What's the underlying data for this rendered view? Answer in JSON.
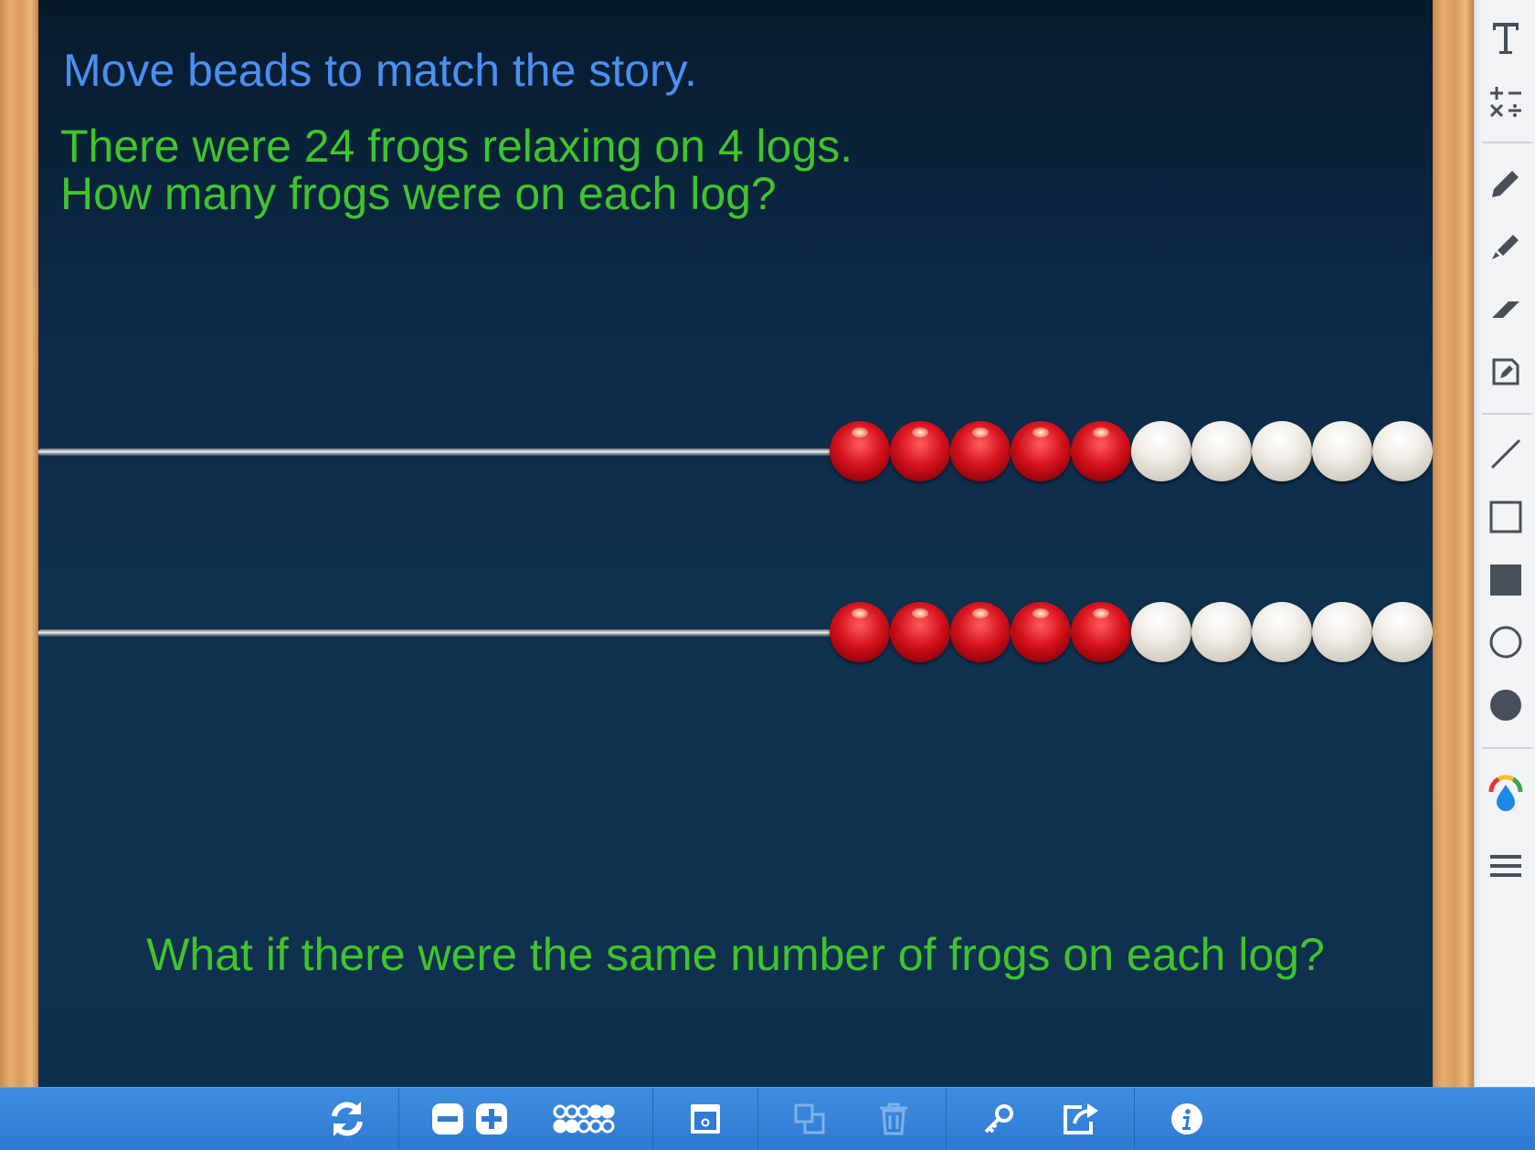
{
  "board": {
    "instruction": "Move beads to match the story.",
    "story_line1": "There were 24 frogs relaxing on 4 logs.",
    "story_line2": "How many frogs were on each log?",
    "question": "What if there were the same number of frogs on each log?"
  },
  "rods": [
    {
      "beads": [
        "red",
        "red",
        "red",
        "red",
        "red",
        "white",
        "white",
        "white",
        "white",
        "white"
      ]
    },
    {
      "beads": [
        "red",
        "red",
        "red",
        "red",
        "red",
        "white",
        "white",
        "white",
        "white",
        "white"
      ]
    }
  ],
  "colors": {
    "heading": "#4b8ff0",
    "story": "#3fc52c",
    "red_bead": "#d5121c",
    "white_bead": "#efece5",
    "toolbar": "#2f7ad3"
  },
  "sidebar_tools": [
    "text-icon",
    "math-symbols-icon",
    "pen-icon",
    "highlighter-icon",
    "eraser-icon",
    "note-icon",
    "line-icon",
    "rectangle-outline-icon",
    "rectangle-filled-icon",
    "circle-outline-icon",
    "circle-filled-icon",
    "color-picker-icon",
    "menu-icon"
  ],
  "bottom_toolbar": [
    "reset-icon",
    "remove-rod-icon",
    "add-rod-icon",
    "bead-layout-icon",
    "cover-icon",
    "duplicate-icon",
    "trash-icon",
    "key-icon",
    "share-icon",
    "info-icon"
  ]
}
